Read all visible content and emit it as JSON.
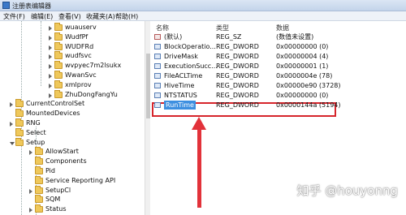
{
  "window": {
    "title": "注册表编辑器"
  },
  "menu": [
    "文件(F)",
    "编辑(E)",
    "查看(V)",
    "收藏夹(A)",
    "帮助(H)"
  ],
  "tree": {
    "items": [
      {
        "label": "wuauserv",
        "indent": 3,
        "expander": "closed"
      },
      {
        "label": "WudfPf",
        "indent": 3,
        "expander": "closed"
      },
      {
        "label": "WUDFRd",
        "indent": 3,
        "expander": "closed"
      },
      {
        "label": "wudfsvc",
        "indent": 3,
        "expander": "closed"
      },
      {
        "label": "wvpyec7m2lsukx",
        "indent": 3,
        "expander": "closed"
      },
      {
        "label": "WwanSvc",
        "indent": 3,
        "expander": "closed"
      },
      {
        "label": "xmlprov",
        "indent": 3,
        "expander": "closed"
      },
      {
        "label": "ZhuDongFangYu",
        "indent": 3,
        "expander": "closed"
      },
      {
        "label": "CurrentControlSet",
        "indent": 1,
        "expander": "closed"
      },
      {
        "label": "MountedDevices",
        "indent": 1,
        "expander": "none"
      },
      {
        "label": "RNG",
        "indent": 1,
        "expander": "closed"
      },
      {
        "label": "Select",
        "indent": 1,
        "expander": "none"
      },
      {
        "label": "Setup",
        "indent": 1,
        "expander": "open"
      },
      {
        "label": "AllowStart",
        "indent": 2,
        "expander": "closed"
      },
      {
        "label": "Components",
        "indent": 2,
        "expander": "none"
      },
      {
        "label": "Pid",
        "indent": 2,
        "expander": "none"
      },
      {
        "label": "Service Reporting API",
        "indent": 2,
        "expander": "none"
      },
      {
        "label": "SetupCl",
        "indent": 2,
        "expander": "closed"
      },
      {
        "label": "SQM",
        "indent": 2,
        "expander": "none"
      },
      {
        "label": "Status",
        "indent": 2,
        "expander": "closed"
      }
    ]
  },
  "values": {
    "columns": [
      "名称",
      "类型",
      "数据"
    ],
    "rows": [
      {
        "name": "(默认)",
        "type": "REG_SZ",
        "data": "(数值未设置)",
        "icon": "string"
      },
      {
        "name": "BlockOperatio...",
        "type": "REG_DWORD",
        "data": "0x00000000 (0)",
        "icon": "dword"
      },
      {
        "name": "DriveMask",
        "type": "REG_DWORD",
        "data": "0x00000004 (4)",
        "icon": "dword"
      },
      {
        "name": "ExecutionSucc...",
        "type": "REG_DWORD",
        "data": "0x00000001 (1)",
        "icon": "dword"
      },
      {
        "name": "FileACLTime",
        "type": "REG_DWORD",
        "data": "0x0000004e (78)",
        "icon": "dword"
      },
      {
        "name": "HiveTime",
        "type": "REG_DWORD",
        "data": "0x00000e90 (3728)",
        "icon": "dword"
      },
      {
        "name": "NTSTATUS",
        "type": "REG_DWORD",
        "data": "0x00000000 (0)",
        "icon": "dword"
      },
      {
        "name": "RunTime",
        "type": "REG_DWORD",
        "data": "0x0000144a (5194)",
        "icon": "dword",
        "selected": true
      }
    ]
  },
  "watermark": "知乎 @houyonng",
  "colors": {
    "highlight_box": "#d6252b",
    "arrow": "#e2323a",
    "selection": "#3d8fe0"
  }
}
